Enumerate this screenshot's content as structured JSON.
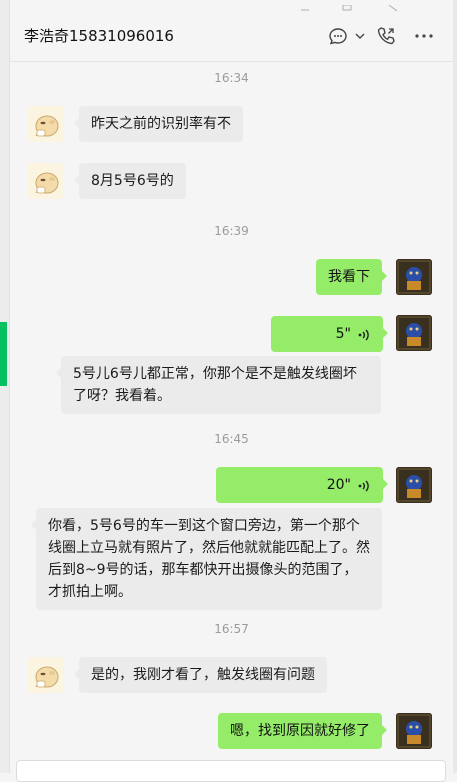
{
  "window": {
    "accent_color": "#07c160"
  },
  "header": {
    "title": "李浩奇15831096016",
    "icons": [
      "chat-bubble-icon",
      "chevron-down-icon",
      "phone-icon",
      "more-icon"
    ]
  },
  "messages": {
    "t1": "16:34",
    "m1": "昨天之前的识别率有不",
    "m2": "8月5号6号的",
    "t2": "16:39",
    "m3": "我看下",
    "m4_duration": "5\"",
    "m5": "5号儿6号儿都正常，你那个是不是触发线圈坏了呀？我看着。",
    "t3": "16:45",
    "m6_duration": "20\"",
    "m7": "你看，5号6号的车一到这个窗口旁边，第一个那个线圈上立马就有照片了，然后他就就能匹配上了。然后到8~9号的话，那车都快开出摄像头的范围了，才抓拍上啊。",
    "t4": "16:57",
    "m8": "是的，我刚才看了，触发线圈有问题",
    "m9": "嗯，找到原因就好修了"
  },
  "colors": {
    "outgoing_bubble": "#95ec69",
    "incoming_bubble": "#ebebeb",
    "timestamp": "#9b9b9b"
  }
}
